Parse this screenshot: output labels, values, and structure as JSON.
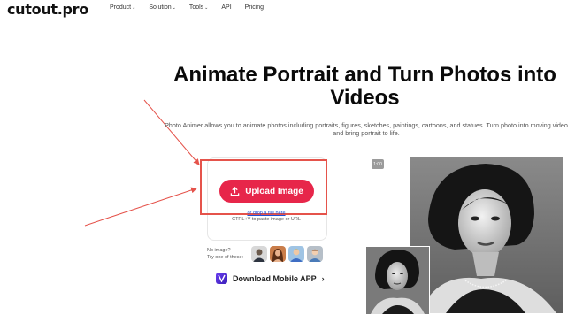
{
  "header": {
    "logo": "cutout.pro",
    "nav": [
      {
        "label": "Product",
        "caret": "⌄"
      },
      {
        "label": "Solution",
        "caret": "⌄"
      },
      {
        "label": "Tools",
        "caret": "⌄"
      },
      {
        "label": "API",
        "caret": ""
      },
      {
        "label": "Pricing",
        "caret": ""
      }
    ]
  },
  "hero": {
    "title": "Animate Portrait and Turn Photos into Videos",
    "subtitle": "Photo Animer allows you to animate photos including portraits, figures, sketches, paintings, cartoons, and statues. Turn photo into moving video and bring portrait to life."
  },
  "upload": {
    "button_label": "Upload Image",
    "drop_hint": "or drop a file here",
    "paste_hint": "CTRL+V to paste image or URL"
  },
  "samples": {
    "no_image": "No image?",
    "try_one": "Try one of these:"
  },
  "download": {
    "label": "Download Mobile APP",
    "arrow": "›"
  },
  "preview": {
    "badge": "1:00"
  },
  "colors": {
    "accent": "#e7264a",
    "annotation_red": "#e5534b"
  }
}
